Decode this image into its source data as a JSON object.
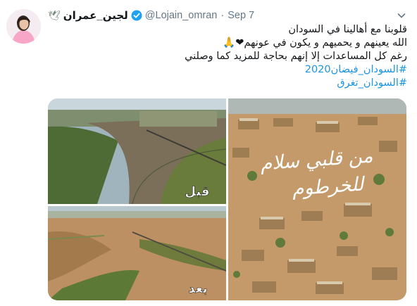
{
  "tweet": {
    "name": "لجين_عمران",
    "handle": "@Lojain_omran",
    "separator": "·",
    "date": "Sep 7",
    "lines": [
      "قلوبنا مع أهالينا في السودان",
      "الله يعينهم و يحميهم و يكون في عونهم",
      "رغم كل المساعدات إلا إنهم بحاجة للمزيد كما وصلني"
    ],
    "line2_emojis": "❤🙏",
    "hashtags": [
      "#السودان_فيضان2020",
      "#السودان_تغرق"
    ]
  },
  "media": {
    "before_label": "قبل",
    "after_label": "بعد",
    "overlay_text_1": "من قلبي سلام",
    "overlay_text_2": "للخرطوم"
  },
  "colors": {
    "link": "#1b95e0",
    "verified": "#1da1f2",
    "muted": "#657786"
  }
}
